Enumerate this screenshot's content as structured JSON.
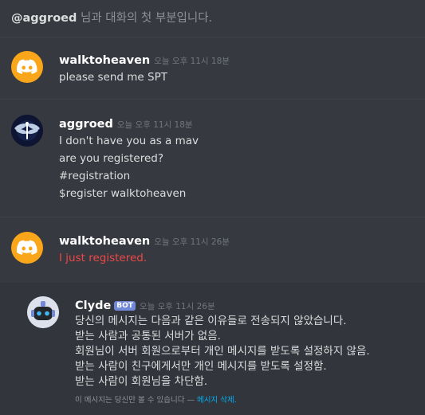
{
  "intro": {
    "mention": "@aggroed",
    "text": " 님과 대화의 첫 부분입니다."
  },
  "messages": [
    {
      "username": "walktoheaven",
      "timestamp": "오늘 오후 11시 18분",
      "lines": [
        "please send me SPT"
      ]
    },
    {
      "username": "aggroed",
      "timestamp": "오늘 오후 11시 18분",
      "lines": [
        "I don't have you as a mav",
        "are you registered?",
        "#registration",
        "$register walktoheaven"
      ]
    },
    {
      "username": "walktoheaven",
      "timestamp": "오늘 오후 11시 26분",
      "lines": [
        "I just registered."
      ]
    }
  ],
  "clyde": {
    "username": "Clyde",
    "badge": "BOT",
    "timestamp": "오늘 오후 11시 26분",
    "lines": [
      "당신의 메시지는 다음과 같은 이유들로 전송되지 않았습니다.",
      "받는 사람과 공통된 서버가 없음.",
      "회원님이 서버 회원으로부터 개인 메시지를 받도록 설정하지 않음.",
      "받는 사람이 친구에게서만 개인 메시지를 받도록 설정함.",
      "받는 사람이 회원님을 차단함."
    ],
    "ephemeral_text": "이 메시지는 당신만 볼 수 있습니다 — ",
    "delete_link": "메시지 삭제."
  },
  "colors": {
    "background": "#36393f",
    "failed": "#f04747",
    "bot_badge": "#7289da",
    "discord_avatar": "#faa61a",
    "link": "#00b0f4"
  },
  "icons": {
    "discord_avatar": "discord-logo-icon",
    "aggroed_avatar": "dragonfly-icon",
    "clyde_avatar": "clyde-robot-icon"
  }
}
